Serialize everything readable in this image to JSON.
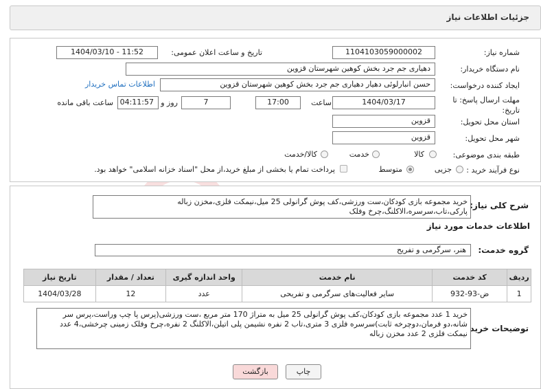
{
  "header": {
    "title": "جزئیات اطلاعات نیاز"
  },
  "fields": {
    "need_number_label": "شماره نیاز:",
    "need_number": "1104103059000002",
    "announce_label": "تاریخ و ساعت اعلان عمومی:",
    "announce_value": "1404/03/10 - 11:52",
    "buyer_org_label": "نام دستگاه خریدار:",
    "buyer_org": "دهیاری جم جرد بخش کوهین شهرستان قزوین",
    "requester_label": "ایجاد کننده درخواست:",
    "requester": "حسن انبارلوئی دهیار دهیاری جم جرد بخش کوهین شهرستان قزوین",
    "contact_link": "اطلاعات تماس خریدار",
    "deadline_label": "مهلت ارسال پاسخ: تا تاریخ:",
    "deadline_date": "1404/03/17",
    "time_label": "ساعت",
    "deadline_time": "17:00",
    "days_value": "7",
    "days_label": "روز و",
    "remaining_time": "04:11:57",
    "remaining_label": "ساعت باقی مانده",
    "province_label": "استان محل تحویل:",
    "province": "قزوین",
    "city_label": "شهر محل تحویل:",
    "city": "قزوین",
    "category_label": "طبقه بندی موضوعی:",
    "category_options": [
      "کالا",
      "خدمت",
      "کالا/خدمت"
    ],
    "process_label": "نوع فرآیند خرید :",
    "process_options": [
      "جزیی",
      "متوسط"
    ],
    "payment_note": "پرداخت تمام یا بخشی از مبلغ خرید،از محل \"اسناد خزانه اسلامی\" خواهد بود."
  },
  "summary": {
    "label": "شرح کلی نیاز:",
    "text": "خرید مجموعه بازی کودکان،ست ورزشی،کف پوش گرانولی 25 میل،نیمکت فلزی،مخزن زباله پارکی،تاب،سرسره،الاکلنگ،چرخ وفلک"
  },
  "services": {
    "section_title": "اطلاعات خدمات مورد نیاز",
    "group_label": "گروه خدمت:",
    "group_value": "هنر، سرگرمی و تفریح",
    "columns": [
      "ردیف",
      "کد خدمت",
      "نام خدمت",
      "واحد اندازه گیری",
      "تعداد / مقدار",
      "تاریخ نیاز"
    ],
    "rows": [
      [
        "1",
        "ض-93-932",
        "سایر فعالیت‌های سرگرمی و تفریحی",
        "عدد",
        "12",
        "1404/03/28"
      ]
    ]
  },
  "buyer_notes": {
    "label": "توضیحات خریدار:",
    "text": "خرید 1 عدد مجموعه بازی کودکان،کف پوش گرانولی 25 میل به متراژ 170 متر مربع ،ست ورزشی(پرس پا چپ وراست،پرس سر شانه،دو فرمان،دوچرخه ثابت)سرسره فلزی 3 متری،تاب 2 نفره نشیمن پلی اتیلن،الاکلنگ 2 نفره،چرخ وفلک زمینی چرخشی،4 عدد نیمکت فلزی 2 عدد مخزن زباله"
  },
  "buttons": {
    "print": "چاپ",
    "back": "بازگشت"
  },
  "colors": {
    "back_button_bg": "#f9d9d9",
    "link": "#1f6fbf",
    "table_header": "#d9d9d9"
  }
}
